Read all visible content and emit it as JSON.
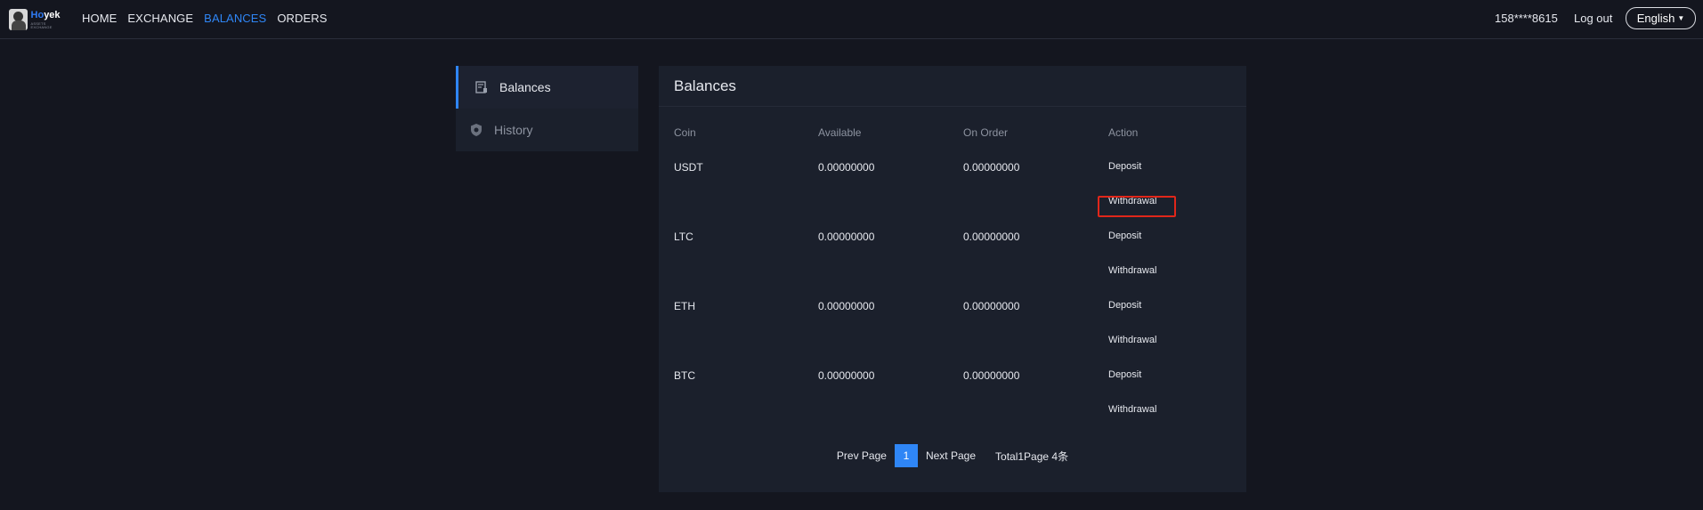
{
  "logo": {
    "word_a": "Ho",
    "word_b": "yek",
    "sub": "ASSETS EXCHANGE"
  },
  "nav": {
    "items": [
      {
        "label": "HOME",
        "active": false
      },
      {
        "label": "EXCHANGE",
        "active": false
      },
      {
        "label": "BALANCES",
        "active": true
      },
      {
        "label": "ORDERS",
        "active": false
      }
    ]
  },
  "user": {
    "phone": "158****8615",
    "logout": "Log out",
    "language": "English"
  },
  "sidebar": {
    "items": [
      {
        "label": "Balances",
        "icon": "wallet-icon",
        "active": true
      },
      {
        "label": "History",
        "icon": "shield-icon",
        "active": false
      }
    ]
  },
  "panel": {
    "title": "Balances",
    "columns": {
      "coin": "Coin",
      "available": "Available",
      "on_order": "On Order",
      "action": "Action"
    },
    "rows": [
      {
        "coin": "USDT",
        "available": "0.00000000",
        "on_order": "0.00000000",
        "deposit": "Deposit",
        "withdrawal": "Withdrawal"
      },
      {
        "coin": "LTC",
        "available": "0.00000000",
        "on_order": "0.00000000",
        "deposit": "Deposit",
        "withdrawal": "Withdrawal"
      },
      {
        "coin": "ETH",
        "available": "0.00000000",
        "on_order": "0.00000000",
        "deposit": "Deposit",
        "withdrawal": "Withdrawal"
      },
      {
        "coin": "BTC",
        "available": "0.00000000",
        "on_order": "0.00000000",
        "deposit": "Deposit",
        "withdrawal": "Withdrawal"
      }
    ]
  },
  "pagination": {
    "prev": "Prev Page",
    "current": "1",
    "next": "Next Page",
    "total": "Total1Page 4条"
  },
  "colors": {
    "accent": "#2f86f6",
    "background": "#14161f",
    "panel": "#1b202c",
    "highlight": "#e0261a"
  }
}
